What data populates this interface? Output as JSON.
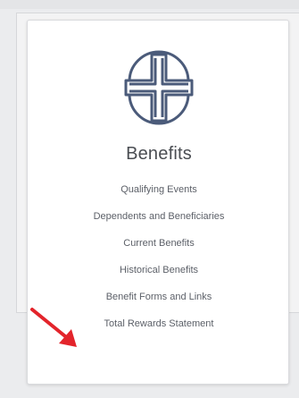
{
  "card": {
    "title": "Benefits",
    "icon": "benefits-cross-globe-icon",
    "links": [
      "Qualifying Events",
      "Dependents and Beneficiaries",
      "Current Benefits",
      "Historical Benefits",
      "Benefit Forms and Links",
      "Total Rewards Statement"
    ]
  },
  "colors": {
    "icon": "#4b5b7a",
    "arrow": "#e3242b",
    "text": "#5c6068"
  }
}
